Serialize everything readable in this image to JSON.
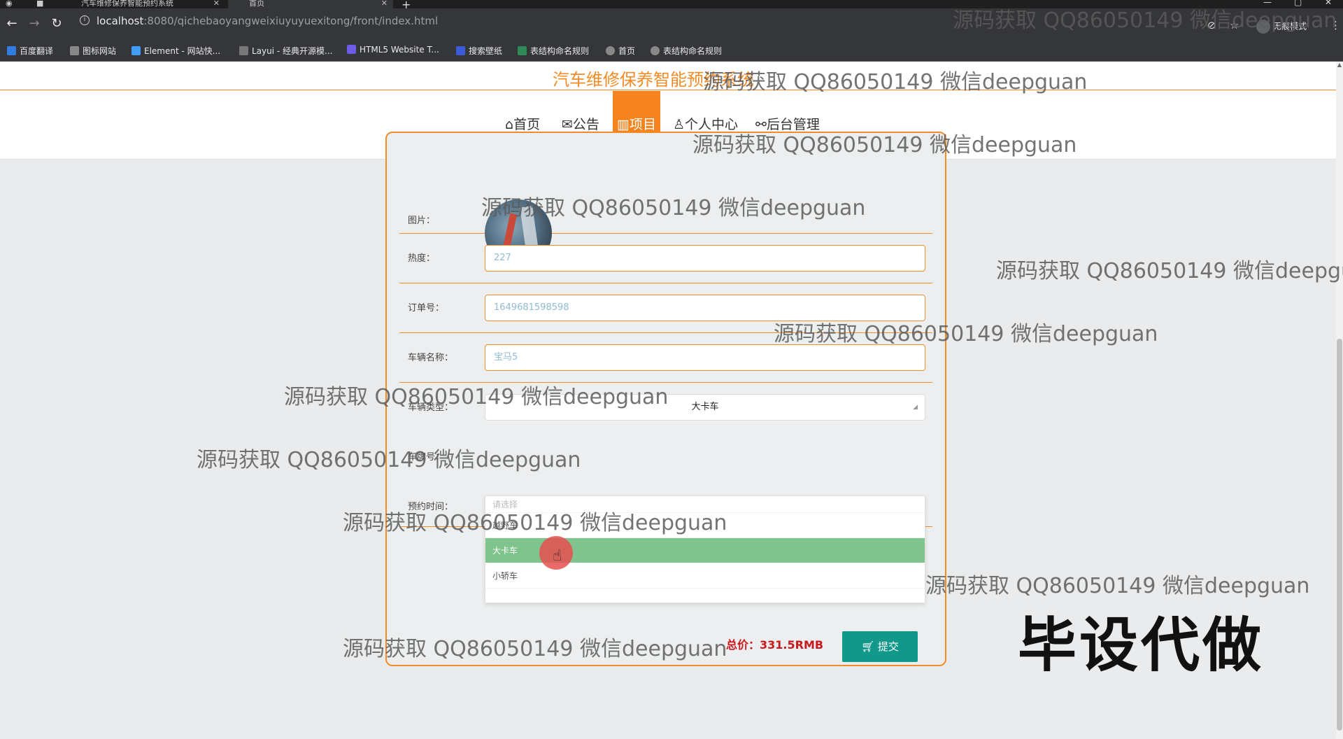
{
  "browser": {
    "tabs": [
      {
        "title": "汽车维修保养智能预约系统",
        "active": false
      },
      {
        "title": "首页",
        "active": true
      }
    ],
    "url_host": "localhost",
    "url_rest": ":8080/qichebaoyangweixiuyuyuexitong/front/index.html",
    "incognito_label": "无痕模式",
    "bookmarks": [
      {
        "label": "百度翻译",
        "color": "#2f7de1"
      },
      {
        "label": "图标网站",
        "color": "#888888"
      },
      {
        "label": "Element - 网站快...",
        "color": "#409eff"
      },
      {
        "label": "Layui - 经典开源模...",
        "color": "#777777"
      },
      {
        "label": "HTML5 Website T...",
        "color": "#6c5ce7"
      },
      {
        "label": "搜索壁纸",
        "color": "#3b5bdb"
      },
      {
        "label": "表结构命名规则",
        "color": "#2e8b57"
      },
      {
        "label": "首页",
        "color": "#888888"
      },
      {
        "label": "表结构命名规则",
        "color": "#888888"
      }
    ]
  },
  "site": {
    "title": "汽车维修保养智能预约系统",
    "nav": [
      {
        "icon": "⌂",
        "label": "首页"
      },
      {
        "icon": "✉",
        "label": "公告"
      },
      {
        "icon": "▥",
        "label": "项目",
        "active": true
      },
      {
        "icon": "♙",
        "label": "个人中心"
      },
      {
        "icon": "⚯",
        "label": "后台管理"
      }
    ]
  },
  "form": {
    "image_label": "图片：",
    "heat_label": "热度：",
    "heat_value": "227",
    "order_label": "订单号：",
    "order_value": "1649681598598",
    "vehicle_name_label": "车辆名称：",
    "vehicle_name_value": "宝马5",
    "vehicle_type_label": "车辆类型：",
    "vehicle_type_value": "大卡车",
    "plate_label": "车牌号：",
    "appointment_label": "预约时间：",
    "vehicle_type_options": [
      "请选择",
      "越野车",
      "大卡车",
      "小轿车"
    ],
    "selected_option": "大卡车",
    "total_label": "总价：",
    "total_value": "331.5RMB",
    "submit_label": "提交"
  },
  "watermarks": {
    "text": "源码获取 QQ86050149 微信deepguan",
    "big": "毕设代做"
  },
  "colors": {
    "accent": "#f28c28",
    "nav_active": "#f5841f",
    "submit": "#12988a",
    "price": "#c8191e",
    "selected_option": "#7fc48c"
  }
}
